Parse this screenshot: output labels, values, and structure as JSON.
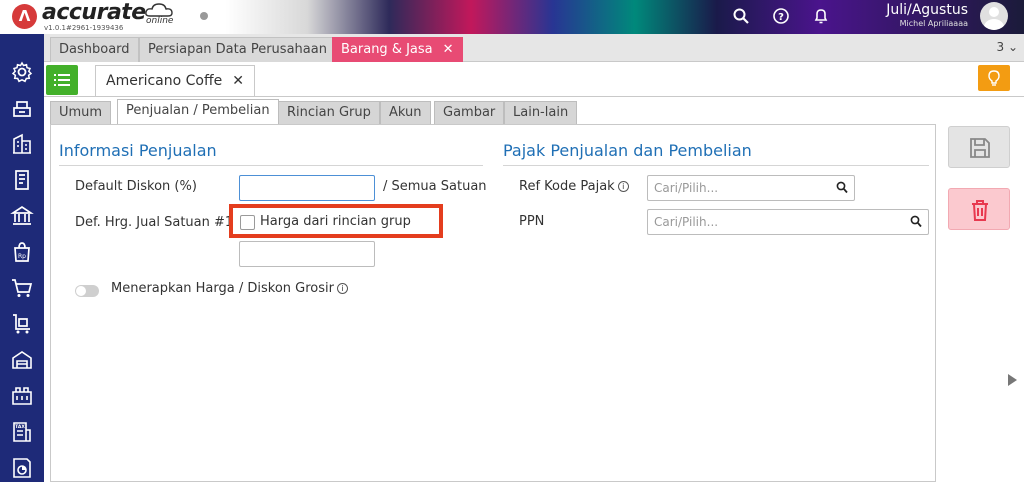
{
  "header": {
    "brand": "accurate",
    "brand_sub": "online",
    "version": "v1.0.1#2961-1939436",
    "user_name": "Juli/Agustus",
    "user_sub": "Michel Apriliaaaa"
  },
  "tabs": [
    {
      "label": "Dashboard"
    },
    {
      "label": "Persiapan Data Perusahaan"
    },
    {
      "label": "Barang & Jasa"
    }
  ],
  "tab_count": "3",
  "record_tab": "Americano Coffe",
  "subtabs": [
    "Umum",
    "Penjualan / Pembelian",
    "Rincian Grup",
    "Akun",
    "Gambar",
    "Lain-lain"
  ],
  "sales": {
    "title": "Informasi Penjualan",
    "default_discount_label": "Default Diskon (%)",
    "discount_value": "",
    "all_units_label": "/ Semua Satuan",
    "def_price_label": "Def. Hrg. Jual Satuan #1",
    "group_price_label": "Harga dari rincian grup",
    "price_value": "",
    "wholesale_label": "Menerapkan Harga / Diskon Grosir"
  },
  "tax": {
    "title": "Pajak Penjualan dan Pembelian",
    "ref_label": "Ref Kode Pajak",
    "ref_placeholder": "Cari/Pilih...",
    "ppn_label": "PPN",
    "ppn_placeholder": "Cari/Pilih..."
  },
  "colors": {
    "accent": "#e84b74",
    "sidebar": "#1e2a78",
    "title_blue": "#1f6fb5",
    "highlight": "#e43d1e"
  }
}
